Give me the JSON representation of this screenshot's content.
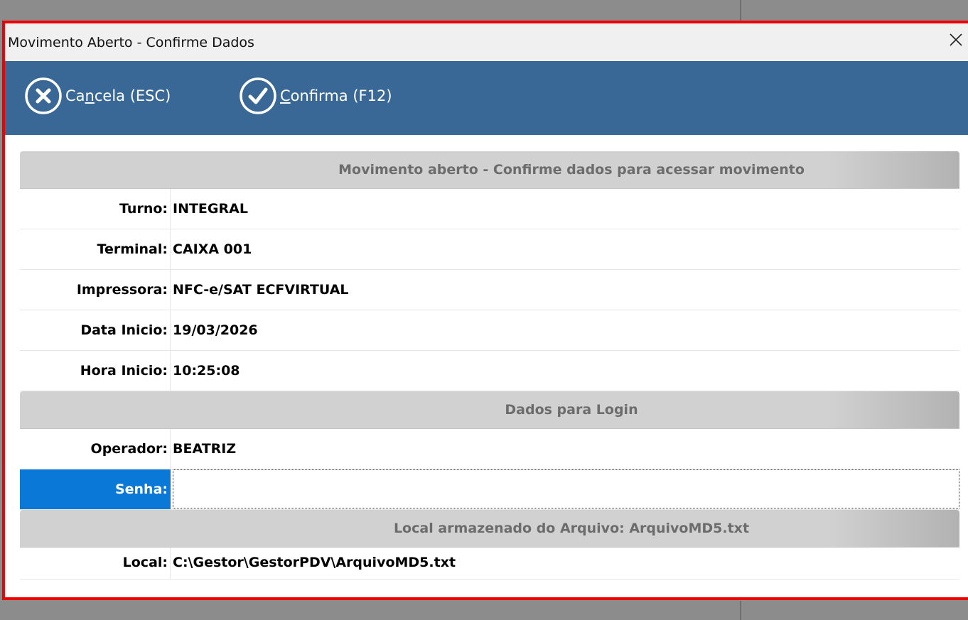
{
  "window": {
    "title": "Movimento Aberto - Confirme Dados",
    "close_symbol": "✕"
  },
  "toolbar": {
    "cancel": {
      "pre": "Ca",
      "accel": "n",
      "post": "cela (ESC)",
      "icon": "cancel-x-circle-icon"
    },
    "confirm": {
      "pre": "",
      "accel": "C",
      "post": "onfirma (F12)",
      "icon": "check-circle-icon"
    },
    "color": "#3a6896"
  },
  "section_movimento": {
    "title": "Movimento aberto - Confirme dados para acessar movimento",
    "rows": [
      {
        "label": "Turno:",
        "value": "INTEGRAL"
      },
      {
        "label": "Terminal:",
        "value": "CAIXA 001"
      },
      {
        "label": "Impressora:",
        "value": "NFC-e/SAT ECFVIRTUAL"
      },
      {
        "label": "Data Inicio:",
        "value": "19/03/2026"
      },
      {
        "label": "Hora Inicio:",
        "value": "10:25:08"
      }
    ]
  },
  "section_login": {
    "title": "Dados para Login",
    "operador": {
      "label": "Operador:",
      "value": "BEATRIZ"
    },
    "senha": {
      "label": "Senha:",
      "value": ""
    }
  },
  "section_arquivo": {
    "title": "Local armazenado do Arquivo: ArquivoMD5.txt",
    "local": {
      "label": "Local:",
      "value": "C:\\Gestor\\GestorPDV\\ArquivoMD5.txt"
    }
  },
  "colors": {
    "dialog_border": "#ee0000",
    "active_row": "#0a78d7"
  }
}
